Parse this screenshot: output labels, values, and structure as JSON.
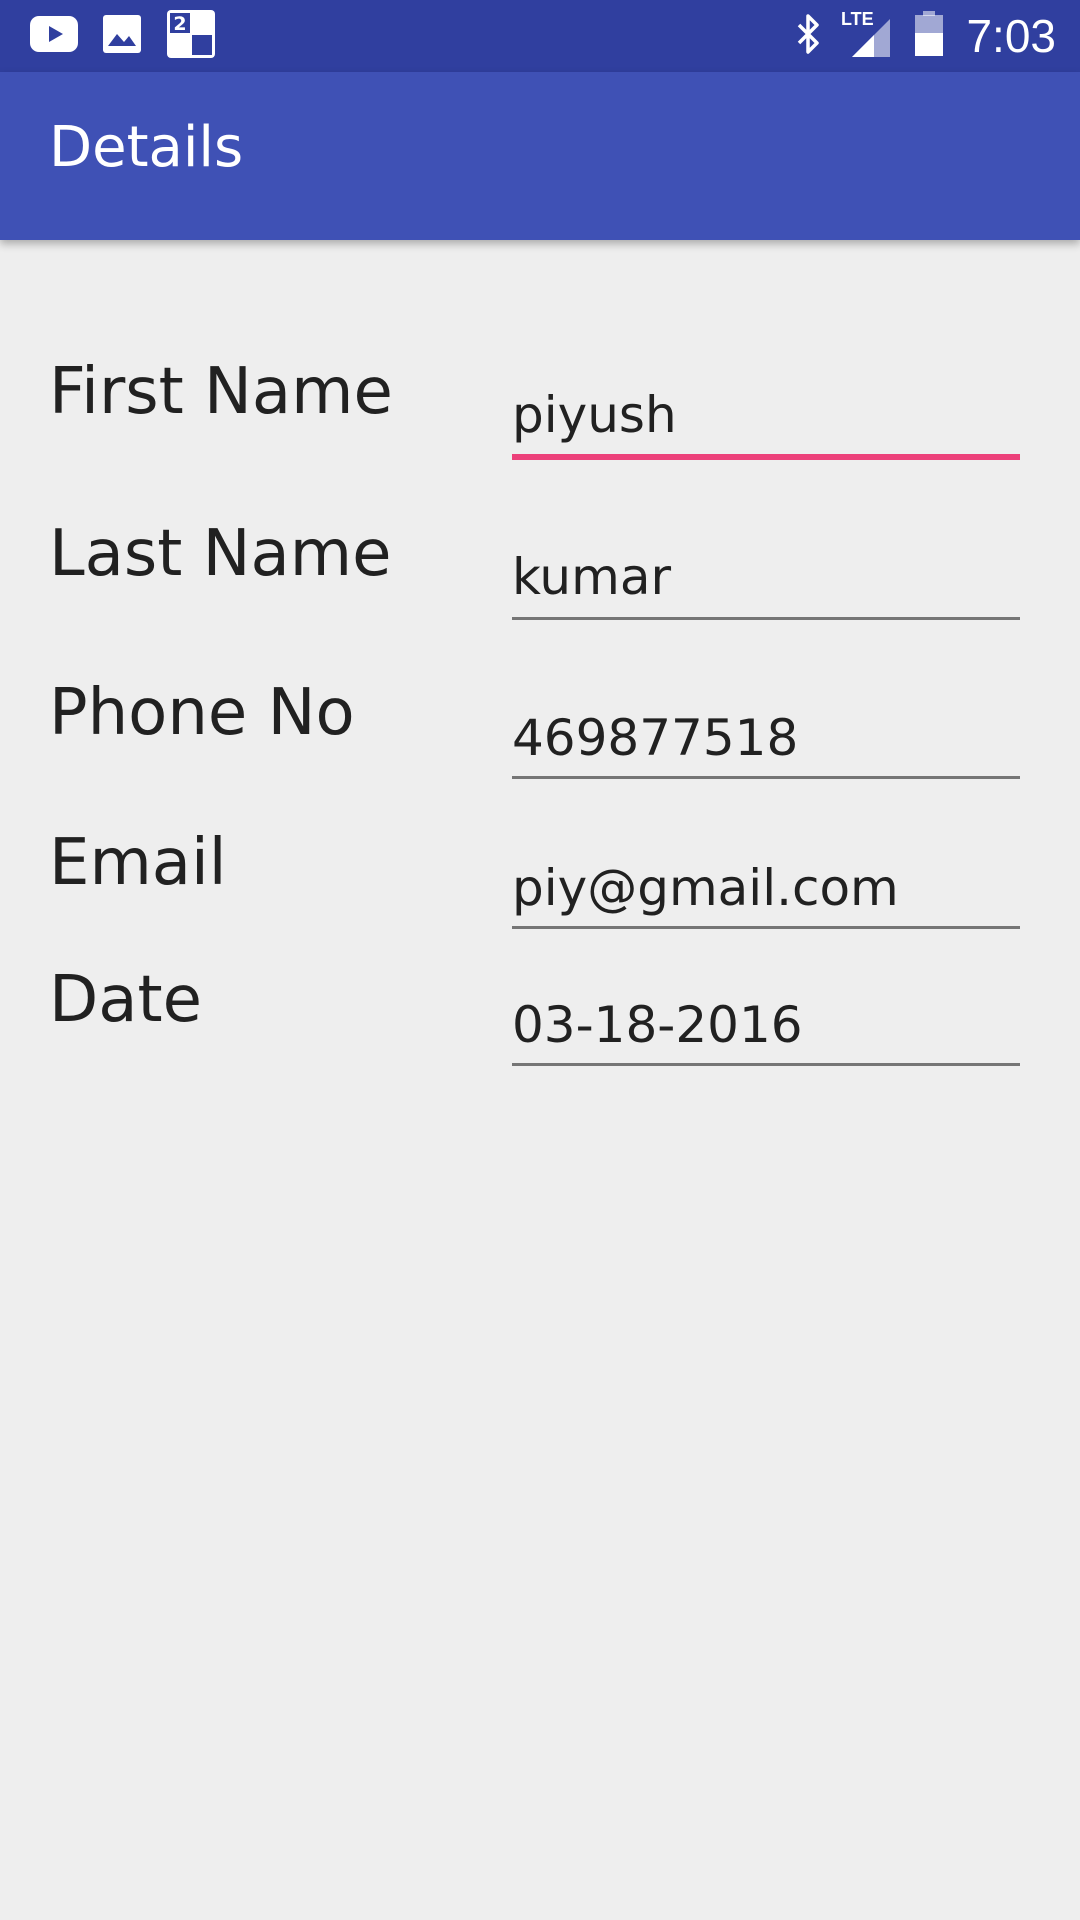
{
  "status_bar": {
    "time": "7:03",
    "network_label": "LTE",
    "notification_badge": "2",
    "icons": [
      "youtube-icon",
      "gallery-icon",
      "notification-app-icon",
      "bluetooth-icon",
      "signal-icon",
      "battery-icon"
    ],
    "background": "#303f9f"
  },
  "app_bar": {
    "title": "Details",
    "background": "#3f51b5"
  },
  "form": {
    "fields": [
      {
        "label": "First Name",
        "value": "piyush",
        "focused": true
      },
      {
        "label": "Last Name",
        "value": "kumar",
        "focused": false
      },
      {
        "label": "Phone No",
        "value": "469877518",
        "focused": false
      },
      {
        "label": "Email",
        "value": "piy@gmail.com",
        "focused": false
      },
      {
        "label": "Date",
        "value": "03-18-2016",
        "focused": false
      }
    ],
    "accent_color": "#ec407a",
    "underline_color": "#757575"
  }
}
